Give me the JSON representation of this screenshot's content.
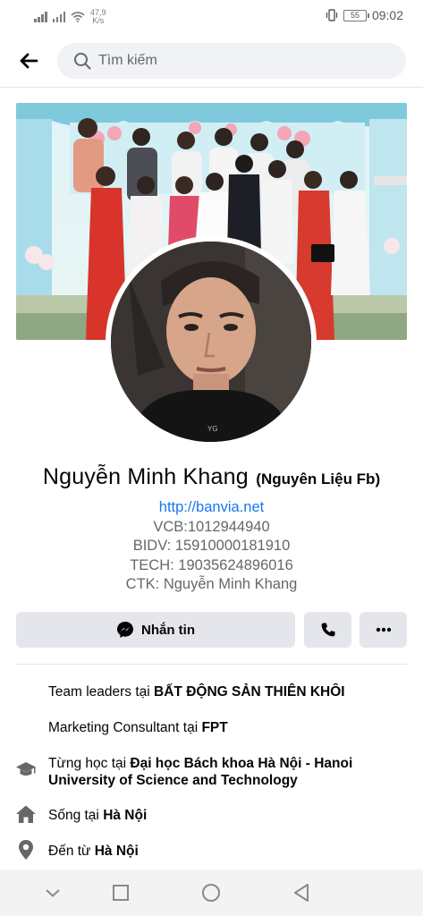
{
  "status_bar": {
    "net_speed_value": "47,9",
    "net_speed_unit": "K/s",
    "battery": "55",
    "time": "09:02"
  },
  "header": {
    "back_icon": "arrow-left-icon",
    "search_placeholder": "Tìm kiếm"
  },
  "profile": {
    "name": "Nguyễn Minh Khang",
    "alternate_name": "(Nguyên Liệu Fb)",
    "bio_lines": [
      "http://banvia.net",
      "VCB:1012944940",
      "BIDV: 15910000181910",
      "TECH: 19035624896016",
      "CTK: Nguyễn Minh Khang"
    ]
  },
  "actions": {
    "message_label": "Nhắn tin",
    "message_icon": "messenger-icon",
    "call_icon": "phone-icon",
    "more_icon": "more-dots-icon"
  },
  "intro": {
    "work1_prefix": "Team leaders tại ",
    "work1_place": "BẤT ĐỘNG SẢN THIÊN KHÔI",
    "work2_prefix": "Marketing Consultant tại ",
    "work2_place": "FPT",
    "edu_prefix": "Từng học tại ",
    "edu_place": "Đại học Bách khoa Hà Nội - Hanoi University of Science and Technology",
    "lives_prefix": "Sống tại ",
    "lives_place": "Hà Nội",
    "from_prefix": "Đến từ ",
    "from_place": "Hà Nội",
    "icons": [
      "graduation-cap-icon",
      "home-icon",
      "location-pin-icon"
    ]
  },
  "nav_bar": {
    "icons": [
      "chevron-down-icon",
      "recents-square-icon",
      "home-circle-icon",
      "back-triangle-icon"
    ]
  },
  "colors": {
    "link": "#1877f2",
    "secondary_text": "#65676b",
    "button_bg": "#e4e6eb",
    "search_bg": "#f0f2f5"
  }
}
